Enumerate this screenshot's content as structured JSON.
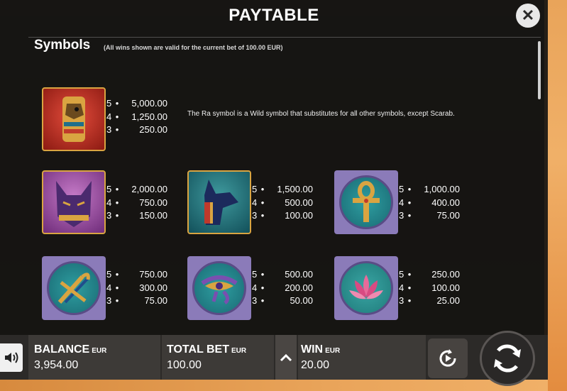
{
  "header": {
    "title": "PAYTABLE",
    "close_label": "✕"
  },
  "section": {
    "title": "Symbols",
    "note": "(All wins shown are valid for the current bet of 100.00 EUR)"
  },
  "symbols": [
    {
      "name": "Ra",
      "icon": "ra-falcon-icon",
      "pays": [
        {
          "count": "5",
          "amount": "5,000.00"
        },
        {
          "count": "4",
          "amount": "1,250.00"
        },
        {
          "count": "3",
          "amount": "250.00"
        }
      ],
      "description": "The Ra symbol is a Wild symbol that substitutes for all other symbols, except Scarab."
    },
    {
      "name": "Bastet",
      "icon": "cat-head-icon",
      "pays": [
        {
          "count": "5",
          "amount": "2,000.00"
        },
        {
          "count": "4",
          "amount": "750.00"
        },
        {
          "count": "3",
          "amount": "150.00"
        }
      ]
    },
    {
      "name": "Anubis",
      "icon": "jackal-head-icon",
      "pays": [
        {
          "count": "5",
          "amount": "1,500.00"
        },
        {
          "count": "4",
          "amount": "500.00"
        },
        {
          "count": "3",
          "amount": "100.00"
        }
      ]
    },
    {
      "name": "Ankh",
      "icon": "ankh-icon",
      "pays": [
        {
          "count": "5",
          "amount": "1,000.00"
        },
        {
          "count": "4",
          "amount": "400.00"
        },
        {
          "count": "3",
          "amount": "75.00"
        }
      ]
    },
    {
      "name": "Crook and Flail",
      "icon": "crook-flail-icon",
      "pays": [
        {
          "count": "5",
          "amount": "750.00"
        },
        {
          "count": "4",
          "amount": "300.00"
        },
        {
          "count": "3",
          "amount": "75.00"
        }
      ]
    },
    {
      "name": "Eye of Horus",
      "icon": "eye-of-horus-icon",
      "pays": [
        {
          "count": "5",
          "amount": "500.00"
        },
        {
          "count": "4",
          "amount": "200.00"
        },
        {
          "count": "3",
          "amount": "50.00"
        }
      ]
    },
    {
      "name": "Lotus",
      "icon": "lotus-flower-icon",
      "pays": [
        {
          "count": "5",
          "amount": "250.00"
        },
        {
          "count": "4",
          "amount": "100.00"
        },
        {
          "count": "3",
          "amount": "25.00"
        }
      ]
    }
  ],
  "bottom_bar": {
    "balance_label": "BALANCE",
    "balance_unit": "EUR",
    "balance_value": "3,954.00",
    "total_bet_label": "TOTAL BET",
    "total_bet_unit": "EUR",
    "total_bet_value": "100.00",
    "win_label": "WIN",
    "win_unit": "EUR",
    "win_value": "20.00"
  },
  "colors": {
    "accent_gold": "#d9a441",
    "sunset_orange": "#e9a45a"
  }
}
